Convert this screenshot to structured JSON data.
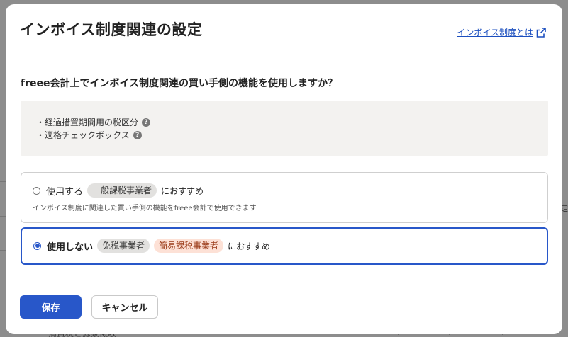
{
  "background": {
    "row_text": "消費税と源泉徴収",
    "edge_text": "設定"
  },
  "modal": {
    "title": "インボイス制度関連の設定",
    "header_link": "インボイス制度とは",
    "question": "freee会計上でインボイス制度関連の買い手側の機能を使用しますか？",
    "info_items": [
      "・経過措置期間用の税区分",
      "・適格チェックボックス"
    ],
    "options": [
      {
        "label": "使用する",
        "tags": [
          "一般課税事業者"
        ],
        "suffix": "におすすめ",
        "description": "インボイス制度に関連した買い手側の機能をfreee会計で使用できます",
        "selected": false
      },
      {
        "label": "使用しない",
        "tags": [
          "免税事業者",
          "簡易課税事業者"
        ],
        "suffix": "におすすめ",
        "selected": true
      }
    ],
    "buttons": {
      "save": "保存",
      "cancel": "キャンセル"
    }
  },
  "colors": {
    "primary": "#2857c9",
    "info_bg": "#f3f2f0",
    "tag_gray": "#e2e1df",
    "tag_orange": "#fde1d6",
    "overlay": "#8d8d8d"
  },
  "icons": {
    "external_link": "external-link-icon",
    "help": "question-circle-icon"
  }
}
